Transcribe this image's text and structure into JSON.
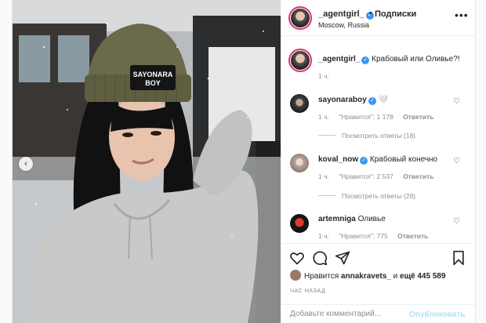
{
  "header": {
    "username": "_agentgirl_",
    "dot": "•",
    "follow_label": "Подписки",
    "location": "Moscow, Russia"
  },
  "caption": {
    "username": "_agentgirl_",
    "text": "Крабовый или Оливье?!",
    "time": "1 ч."
  },
  "comments": [
    {
      "username": "sayonaraboy",
      "text": "🤍",
      "time": "1 ч.",
      "likes": "\"Нравится\": 1 178",
      "reply_label": "Ответить",
      "view_replies": "Посмотреть ответы (18)"
    },
    {
      "username": "koval_now",
      "text": "Крабовый конечно",
      "time": "1 ч.",
      "likes": "\"Нравится\": 2 537",
      "reply_label": "Ответить",
      "view_replies": "Посмотреть ответы (28)"
    },
    {
      "username": "artemniga",
      "text": "Оливье",
      "time": "1 ч.",
      "likes": "\"Нравится\": 775",
      "reply_label": "Ответить"
    }
  ],
  "likes_summary": {
    "prefix": "Нравится",
    "user": "annakravets_",
    "joiner": "и",
    "rest": "ещё 445 589"
  },
  "time_ago": "ЧАС НАЗАД",
  "composer": {
    "placeholder": "Добавьте комментарий...",
    "publish_label": "Опубликовать"
  },
  "image": {
    "cap_text_line1": "SAYONARA",
    "cap_text_line2": "BOY"
  },
  "colors": {
    "verified": "#3897f0",
    "story_ring": "#e1306c",
    "publish_disabled": "#b2dffc",
    "meta_gray": "#8e8e8e",
    "hoodie": "#c9c9c7",
    "beanie": "#6b6a4a"
  },
  "icons": {
    "like": "heart-outline-icon",
    "comment": "speech-bubble-icon",
    "share": "paper-plane-icon",
    "save": "bookmark-icon",
    "more": "ellipsis-icon",
    "carousel_prev": "chevron-left-icon",
    "comment_like": "small-heart-icon",
    "verified": "verified-badge-icon"
  }
}
